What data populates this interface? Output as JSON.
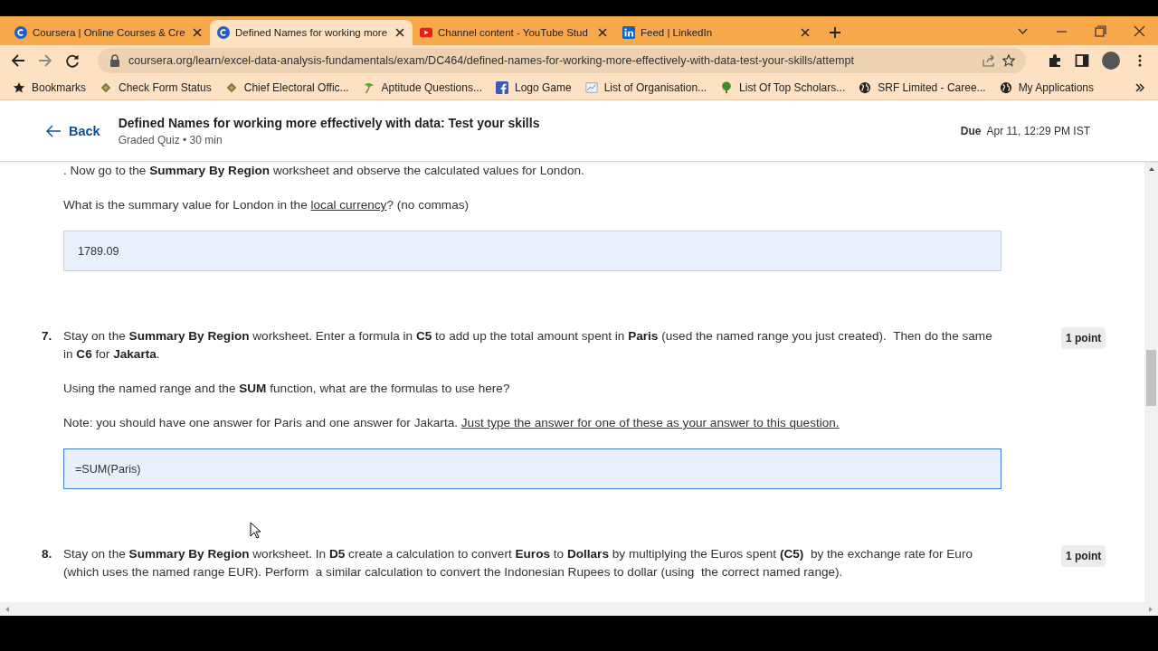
{
  "browser": {
    "tabs": [
      {
        "title": "Coursera | Online Courses & Cre",
        "kind": "coursera",
        "selected": false
      },
      {
        "title": "Defined Names for working more",
        "kind": "coursera",
        "selected": true
      },
      {
        "title": "Channel content - YouTube Stud",
        "kind": "youtube",
        "selected": false
      },
      {
        "title": "Feed | LinkedIn",
        "kind": "linkedin",
        "selected": false
      }
    ],
    "url": "coursera.org/learn/excel-data-analysis-fundamentals/exam/DC464/defined-names-for-working-more-effectively-with-data-test-your-skills/attempt",
    "bookmarks": [
      {
        "label": "Bookmarks",
        "kind": "star"
      },
      {
        "label": "Check Form Status",
        "kind": "ballot"
      },
      {
        "label": "Chief Electoral Offic...",
        "kind": "ballot"
      },
      {
        "label": "Aptitude Questions...",
        "kind": "plant"
      },
      {
        "label": "Logo Game",
        "kind": "facebook"
      },
      {
        "label": "List of Organisation...",
        "kind": "chart"
      },
      {
        "label": "List Of Top Scholars...",
        "kind": "tree"
      },
      {
        "label": "SRF Limited - Caree...",
        "kind": "globe"
      },
      {
        "label": "My Applications",
        "kind": "globe"
      }
    ]
  },
  "header": {
    "back": "Back",
    "title": "Defined Names for working more effectively with data: Test your skills",
    "subtitle": "Graded Quiz • 30 min",
    "due_label": "Due",
    "due_value": "Apr 11, 12:29 PM IST"
  },
  "questions": [
    {
      "paragraphs": [
        [
          {
            "kind": "text",
            "text": ". Now go to the **Summary By Region** worksheet and observe the calculated values for London."
          }
        ],
        [
          {
            "kind": "text",
            "text": "What is the summary value for London in the "
          },
          {
            "kind": "link",
            "text": "local currency"
          },
          {
            "kind": "text",
            "text": "? (no commas)"
          }
        ]
      ],
      "answer": {
        "value": "1789.09",
        "focused": false
      }
    },
    {
      "number": "7.",
      "points": "1 point",
      "paragraphs": [
        [
          {
            "kind": "text",
            "text": "Stay on the **Summary By Region** worksheet. Enter a formula in **C5** to add up the total amount spent in **Paris** (used the named range you just created).  Then do the same in **C6** for **Jakarta**."
          }
        ],
        [
          {
            "kind": "text",
            "text": "Using the named range and the **SUM** function, what are the formulas to use here?"
          }
        ],
        [
          {
            "kind": "text",
            "text": "Note: you should have one answer for Paris and one answer for Jakarta. "
          },
          {
            "kind": "link",
            "text": "Just type the answer for one of these as your answer to this question."
          }
        ]
      ],
      "answer": {
        "value": "=SUM(Paris)",
        "focused": true
      }
    },
    {
      "number": "8.",
      "points": "1 point",
      "paragraphs": [
        [
          {
            "kind": "text",
            "text": "Stay on the **Summary By Region** worksheet. In **D5** create a calculation to convert **Euros** to **Dollars** by multiplying the Euros spent **(C5)**  by the exchange rate for Euro (which uses the named range EUR). Perform  a similar calculation to convert the Indonesian Rupees to dollar (using  the correct named range)."
          }
        ]
      ]
    }
  ]
}
